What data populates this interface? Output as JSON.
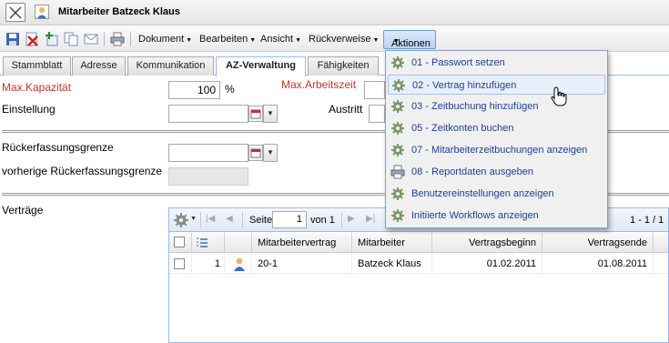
{
  "window": {
    "title": "Mitarbeiter Batzeck Klaus"
  },
  "toolbar": {
    "menus": [
      {
        "label": "Dokument"
      },
      {
        "label": "Bearbeiten"
      },
      {
        "label": "Ansicht"
      },
      {
        "label": "Rückverweise"
      }
    ],
    "active_menu": "Aktionen"
  },
  "tabs": [
    {
      "label": "Stammblatt"
    },
    {
      "label": "Adresse"
    },
    {
      "label": "Kommunikation"
    },
    {
      "label": "AZ-Verwaltung",
      "active": true
    },
    {
      "label": "Fähigkeiten"
    }
  ],
  "form": {
    "max_kapazitaet_label": "Max.Kapazität",
    "max_kapazitaet_value": "100",
    "percent_unit": "%",
    "max_arbeitszeit_label": "Max.Arbeitszeit",
    "einstellung_label": "Einstellung",
    "austritt_label": "Austritt",
    "rueckerfassungsgrenze_label": "Rückerfassungsgrenze",
    "vorherige_label": "vorherige Rückerfassungsgrenze",
    "vertraege_label": "Verträge"
  },
  "grid": {
    "pager": {
      "page_label": "Seite",
      "page_value": "1",
      "of_label": "von 1",
      "count": "1 - 1 / 1"
    },
    "columns": [
      "Mitarbeitervertrag",
      "Mitarbeiter",
      "Vertragsbeginn",
      "Vertragsende"
    ],
    "rows": [
      {
        "num": "1",
        "vertrag": "20-1",
        "mitarbeiter": "Batzeck Klaus",
        "beginn": "01.02.2011",
        "ende": "01.08.2011"
      }
    ]
  },
  "actions_menu": {
    "items": [
      {
        "label": "01 - Passwort setzen",
        "icon": "gear-icon"
      },
      {
        "label": "02 - Vertrag hinzufügen",
        "icon": "gear-icon",
        "hover": true
      },
      {
        "label": "03 - Zeitbuchung hinzufügen",
        "icon": "gear-icon"
      },
      {
        "label": "05 - Zeitkonten buchen",
        "icon": "gear-icon"
      },
      {
        "label": "07 - Mitarbeiterzeitbuchungen anzeigen",
        "icon": "gear-icon"
      },
      {
        "label": "08 - Reportdaten ausgeben",
        "icon": "printer-icon"
      },
      {
        "label": "Benutzereinstellungen anzeigen",
        "icon": "gear-icon"
      },
      {
        "label": "Initiierte Workflows anzeigen",
        "icon": "gear-icon"
      }
    ]
  },
  "colors": {
    "accent": "#99bbe8",
    "required_label": "#c0352e",
    "menu_text": "#1f3f94"
  }
}
